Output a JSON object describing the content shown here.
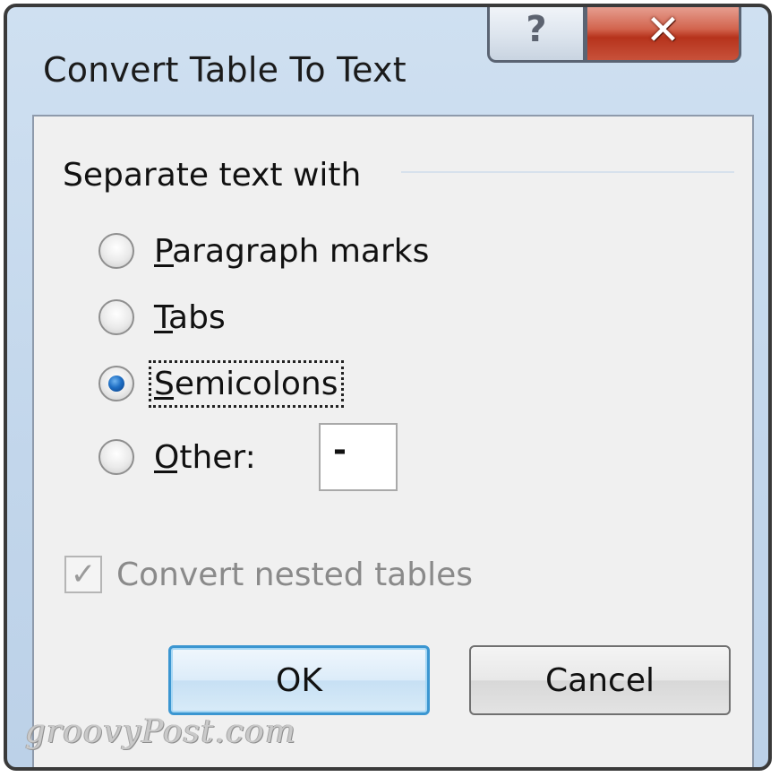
{
  "dialog": {
    "title": "Convert Table To Text",
    "help_glyph": "?",
    "close_glyph": "✕"
  },
  "separator_group": {
    "title": "Separate text with",
    "options": [
      {
        "label": "Paragraph marks",
        "checked": false
      },
      {
        "label": "Tabs",
        "checked": false
      },
      {
        "label": "Semicolons",
        "checked": true
      },
      {
        "label": "Other:",
        "checked": false
      }
    ],
    "other_value": "-"
  },
  "nested": {
    "label": "Convert nested tables",
    "checked": true,
    "enabled": false,
    "check_glyph": "✓"
  },
  "buttons": {
    "ok": "OK",
    "cancel": "Cancel"
  },
  "watermark": "groovyPost.com",
  "colors": {
    "close_button": "#c8513a",
    "selected_radio": "#1f6fc4",
    "default_button_border": "#3b96d1"
  }
}
